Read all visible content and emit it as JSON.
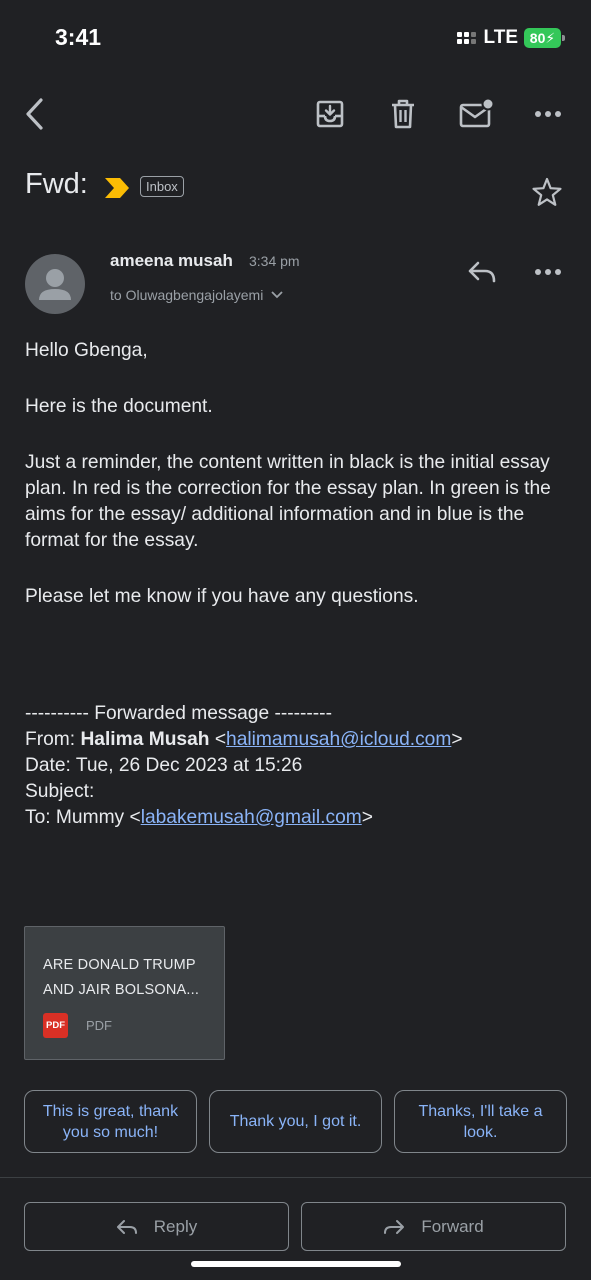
{
  "status_bar": {
    "time": "3:41",
    "network": "LTE",
    "battery": "80"
  },
  "toolbar": {
    "back_icon": "back-arrow-icon",
    "archive_icon": "archive-icon",
    "delete_icon": "trash-icon",
    "mark_unread_icon": "mail-unread-icon",
    "more_icon": "more-horizontal-icon"
  },
  "email": {
    "subject": "Fwd:",
    "label": "Inbox",
    "importance_color": "#fbbc04",
    "sender_name": "ameena musah",
    "time": "3:34 pm",
    "to_line": "to Oluwagbengajolayemi",
    "greeting": "Hello Gbenga,",
    "line1": "Here is the document.",
    "paragraph": "Just a reminder, the content written in black is the initial essay plan. In red is the correction for the essay plan. In green is the aims for the essay/ additional information and in blue is the format for the essay.",
    "closing": "Please let me know if you have any questions.",
    "forwarded": {
      "header": "---------- Forwarded message ---------",
      "from_label": "From:",
      "from_name": "Halima Musah",
      "from_email": "halimamusah@icloud.com",
      "date_line": "Date: Tue, 26 Dec 2023 at 15:26",
      "subject_line": "Subject:",
      "to_label": "To: Mummy",
      "to_email": "labakemusah@gmail.com"
    }
  },
  "attachment": {
    "title_line1": "ARE DONALD TRUMP",
    "title_line2": "AND JAIR BOLSONA...",
    "badge": "PDF",
    "type": "PDF"
  },
  "smart_replies": [
    "This is great, thank you so much!",
    "Thank you, I got it.",
    "Thanks, I'll take a look."
  ],
  "actions": {
    "reply": "Reply",
    "forward": "Forward"
  },
  "colors": {
    "background": "#202124",
    "link": "#8ab4f8",
    "battery": "#34c759",
    "pdf": "#d93025"
  }
}
